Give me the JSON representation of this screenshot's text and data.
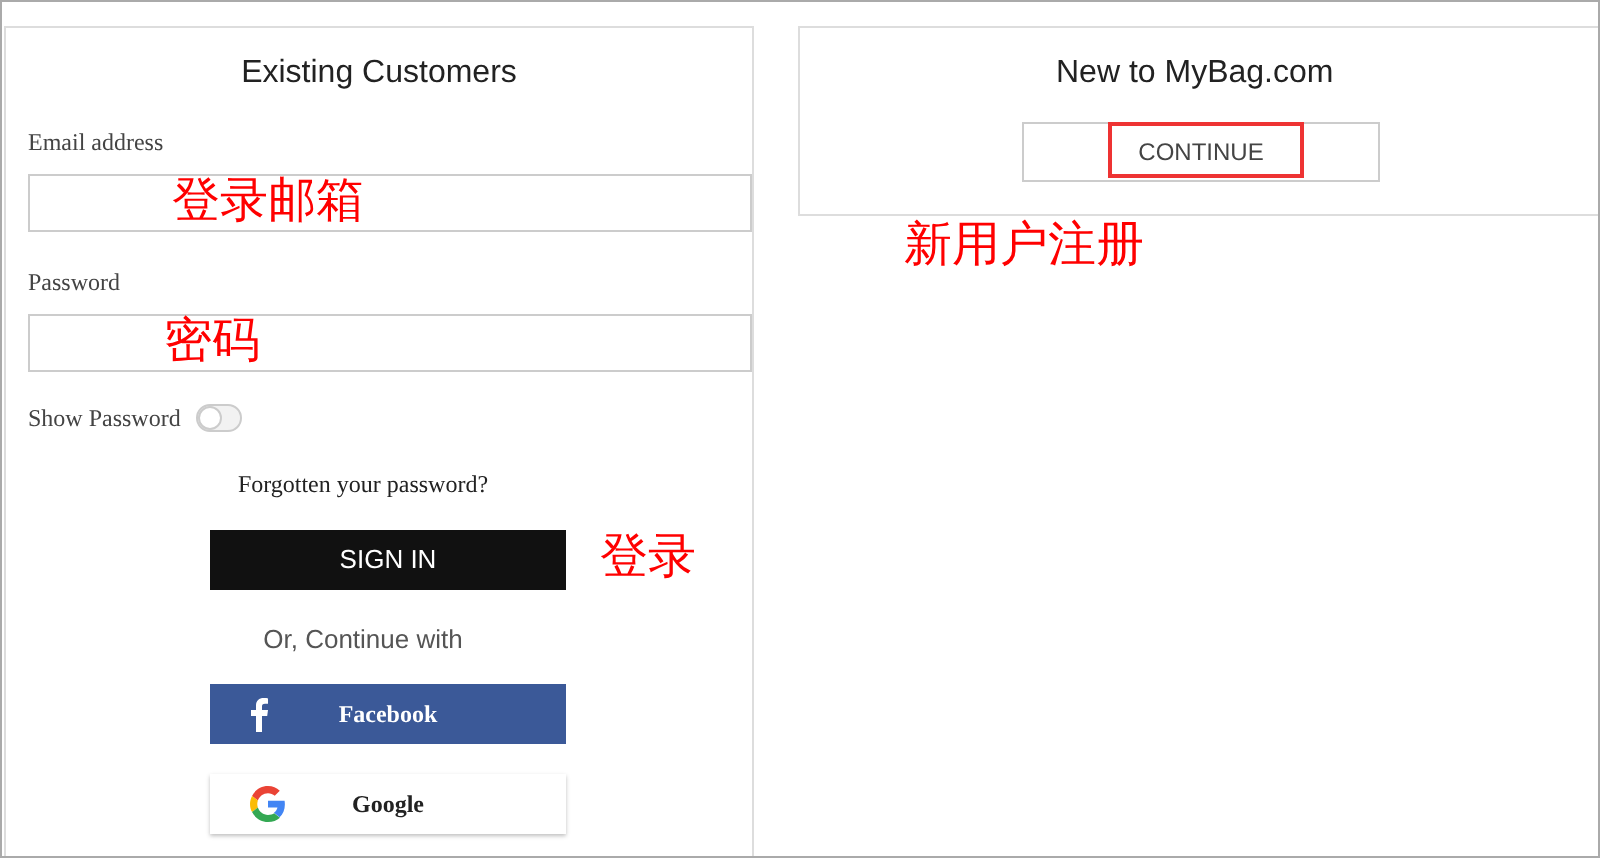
{
  "existing_customers": {
    "title": "Existing Customers",
    "fields": [
      {
        "label": "Email address",
        "annotation": "登录邮箱"
      },
      {
        "label": "Password",
        "annotation": "密码"
      }
    ],
    "show_password": {
      "label": "Show Password",
      "on": false
    },
    "forgot_link": "Forgotten your password?",
    "sign_in_button": "SIGN IN",
    "sign_in_annotation": "登录",
    "divider_text": "Or, Continue with",
    "social_buttons": [
      {
        "kind": "facebook",
        "label": "Facebook"
      },
      {
        "kind": "google",
        "label": "Google"
      }
    ]
  },
  "new_customers": {
    "title": "New to MyBag.com",
    "continue_button": "CONTINUE",
    "continue_highlighted": true,
    "annotation": "新用户注册"
  }
}
